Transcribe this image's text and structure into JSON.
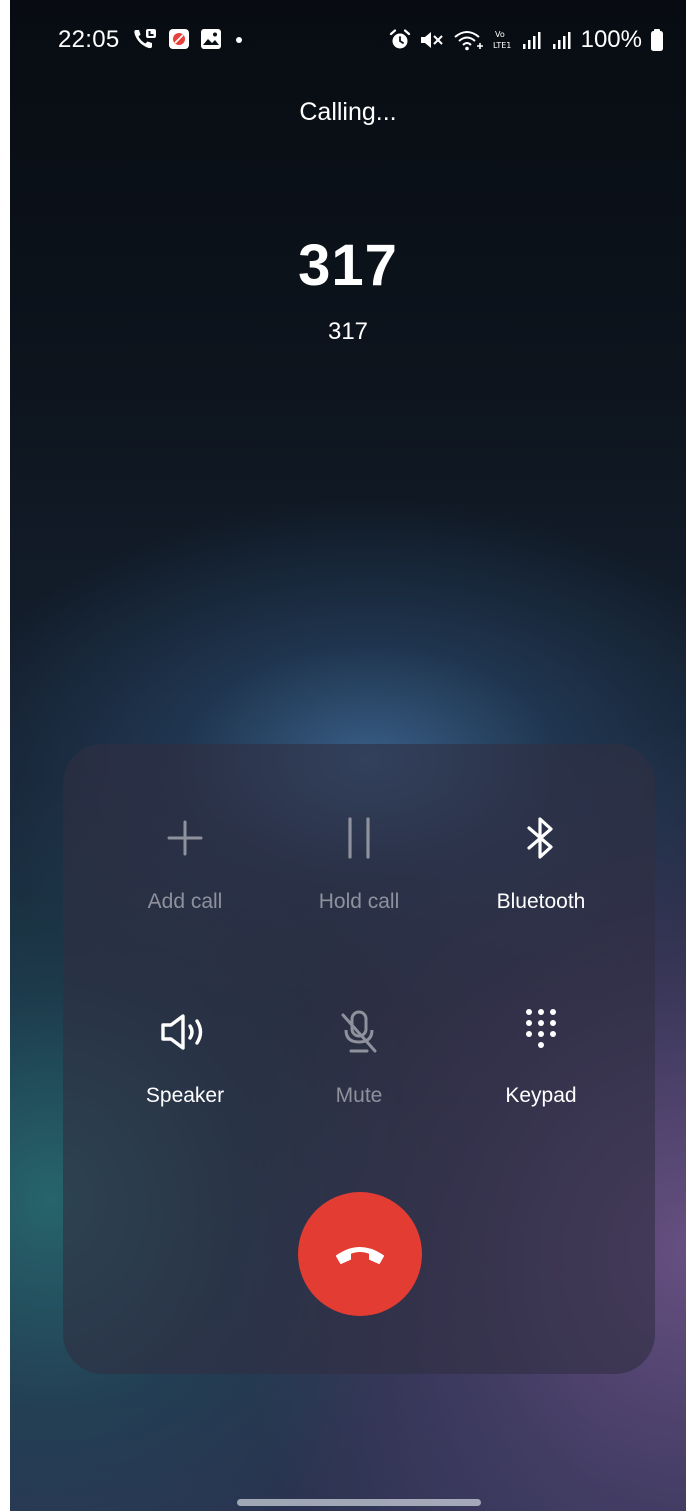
{
  "status_bar": {
    "time": "22:05",
    "battery": "100%",
    "left_icons": [
      "call-icon",
      "app-notification-icon",
      "gallery-icon",
      "dot-icon"
    ],
    "right_icons": [
      "alarm-icon",
      "mute-icon",
      "wifi-calling-icon",
      "volte-icon",
      "signal-icon",
      "signal-icon",
      "battery-icon"
    ]
  },
  "call": {
    "status": "Calling...",
    "name": "317",
    "number": "317"
  },
  "controls": {
    "add_call": {
      "label": "Add call",
      "icon": "plus-icon",
      "enabled": false
    },
    "hold_call": {
      "label": "Hold call",
      "icon": "pause-icon",
      "enabled": false
    },
    "bluetooth": {
      "label": "Bluetooth",
      "icon": "bluetooth-icon",
      "enabled": true
    },
    "speaker": {
      "label": "Speaker",
      "icon": "speaker-icon",
      "enabled": true
    },
    "mute": {
      "label": "Mute",
      "icon": "mic-off-icon",
      "enabled": false
    },
    "keypad": {
      "label": "Keypad",
      "icon": "keypad-icon",
      "enabled": true
    }
  },
  "end_call": {
    "icon": "phone-hangup-icon",
    "color": "#e23c33"
  },
  "colors": {
    "text_primary": "#ffffff",
    "text_disabled": "#8e929c",
    "panel": "#302e42"
  }
}
